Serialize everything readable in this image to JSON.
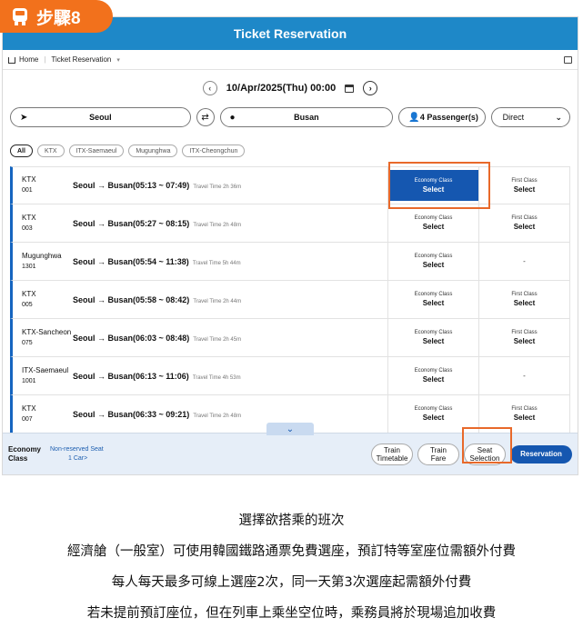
{
  "step_badge": "步驟8",
  "app": {
    "title": "Ticket Reservation",
    "breadcrumb": {
      "home": "Home",
      "current": "Ticket Reservation"
    },
    "date": {
      "value": "10/Apr/2025(Thu) 00:00",
      "prev_icon": "chevron-left-icon",
      "next_icon": "chevron-right-icon"
    },
    "search": {
      "origin": "Seoul",
      "destination": "Busan",
      "passengers": "4 Passenger(s)",
      "route_type": "Direct"
    },
    "filters": [
      "All",
      "KTX",
      "ITX-Saemaeul",
      "Mugunghwa",
      "ITX-Cheongchun"
    ],
    "trains": [
      {
        "name": "KTX",
        "no": "001",
        "route": "Seoul → Busan(05:13 ~ 07:49)",
        "time": "Travel Time 2h 36m",
        "economy_label": "Economy Class",
        "economy_select": "Select",
        "first_label": "First Class",
        "first_select": "Select",
        "first_dash": ""
      },
      {
        "name": "KTX",
        "no": "003",
        "route": "Seoul → Busan(05:27 ~ 08:15)",
        "time": "Travel Time 2h 48m",
        "economy_label": "Economy Class",
        "economy_select": "Select",
        "first_label": "First Class",
        "first_select": "Select",
        "first_dash": ""
      },
      {
        "name": "Mugunghwa",
        "no": "1301",
        "route": "Seoul → Busan(05:54 ~ 11:38)",
        "time": "Travel Time 5h 44m",
        "economy_label": "Economy Class",
        "economy_select": "Select",
        "first_label": "",
        "first_select": "",
        "first_dash": "-"
      },
      {
        "name": "KTX",
        "no": "005",
        "route": "Seoul → Busan(05:58 ~ 08:42)",
        "time": "Travel Time 2h 44m",
        "economy_label": "Economy Class",
        "economy_select": "Select",
        "first_label": "First Class",
        "first_select": "Select",
        "first_dash": ""
      },
      {
        "name": "KTX-Sancheon",
        "no": "075",
        "route": "Seoul → Busan(06:03 ~ 08:48)",
        "time": "Travel Time 2h 45m",
        "economy_label": "Economy Class",
        "economy_select": "Select",
        "first_label": "First Class",
        "first_select": "Select",
        "first_dash": ""
      },
      {
        "name": "ITX-Saemaeul",
        "no": "1001",
        "route": "Seoul → Busan(06:13 ~ 11:06)",
        "time": "Travel Time 4h 53m",
        "economy_label": "Economy Class",
        "economy_select": "Select",
        "first_label": "",
        "first_select": "",
        "first_dash": "-"
      },
      {
        "name": "KTX",
        "no": "007",
        "route": "Seoul → Busan(06:33 ~ 09:21)",
        "time": "Travel Time 2h 48m",
        "economy_label": "Economy Class",
        "economy_select": "Select",
        "first_label": "First Class",
        "first_select": "Select",
        "first_dash": ""
      }
    ],
    "bottom": {
      "class_line1": "Economy",
      "class_line2": "Class",
      "seat_type": "Non-reserved Seat",
      "cars": "1 Car>",
      "btn_timetable_1": "Train",
      "btn_timetable_2": "Timetable",
      "btn_fare_1": "Train",
      "btn_fare_2": "Fare",
      "btn_seat_1": "Seat",
      "btn_seat_2": "Selection",
      "btn_reservation": "Reservation"
    }
  },
  "captions": [
    "選擇欲搭乘的班次",
    "經濟艙（一般室）可使用韓國鐵路通票免費選座，預訂特等室座位需額外付費",
    "每人每天最多可線上選座2次，同一天第3次選座起需額外付費",
    "若未提前預訂座位，但在列車上乘坐空位時，乘務員將於現場追加收費"
  ],
  "colors": {
    "badge": "#f2711c",
    "header": "#1e88c8",
    "primary": "#1557b0",
    "highlight": "#e8692a"
  }
}
